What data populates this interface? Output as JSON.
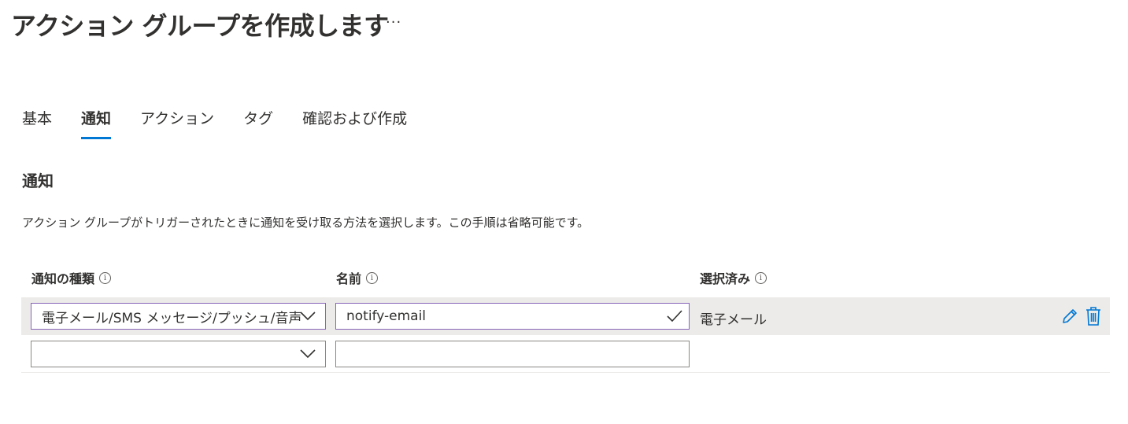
{
  "header": {
    "title": "アクション グループを作成します",
    "more_label": "···"
  },
  "tabs": [
    {
      "label": "基本",
      "active": false
    },
    {
      "label": "通知",
      "active": true
    },
    {
      "label": "アクション",
      "active": false
    },
    {
      "label": "タグ",
      "active": false
    },
    {
      "label": "確認および作成",
      "active": false
    }
  ],
  "section": {
    "title": "通知",
    "description": "アクション グループがトリガーされたときに通知を受け取る方法を選択します。この手順は省略可能です。"
  },
  "table": {
    "headers": {
      "type": "通知の種類",
      "name": "名前",
      "selected": "選択済み"
    },
    "rows": [
      {
        "type": "電子メール/SMS メッセージ/プッシュ/音声",
        "name": "notify-email",
        "selected": "電子メール"
      },
      {
        "type": "",
        "name": "",
        "selected": ""
      }
    ]
  },
  "colors": {
    "accent": "#0078d4",
    "field_border_active": "#8764b8",
    "row_highlight": "#edebe9"
  },
  "icons": [
    "more-icon",
    "info-icon",
    "chevron-down-icon",
    "checkmark-icon",
    "edit-pencil-icon",
    "delete-trash-icon"
  ]
}
